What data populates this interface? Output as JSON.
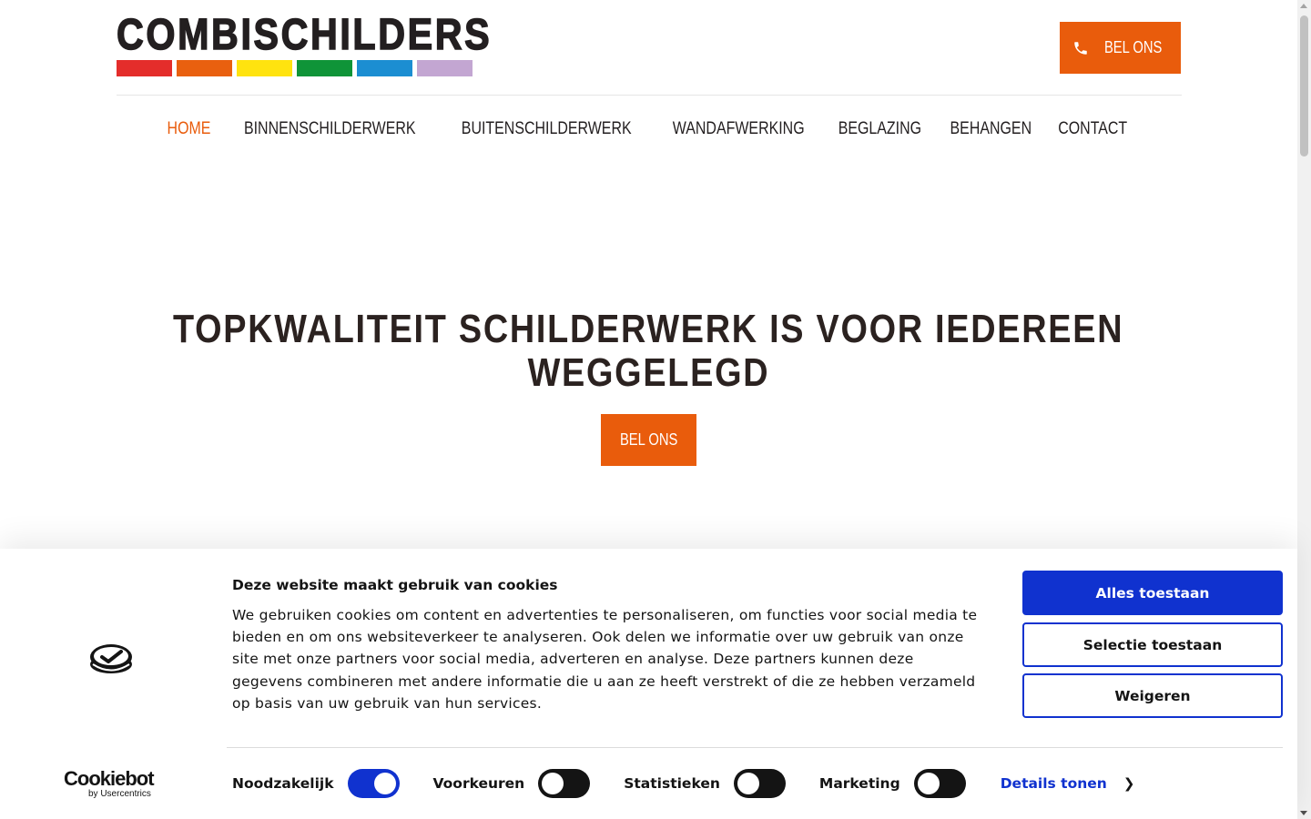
{
  "header": {
    "logo_text": "COMBISCHILDERS",
    "logo_colors": [
      "#e42d2b",
      "#e9600f",
      "#ffe30f",
      "#0f9438",
      "#1c8ed2",
      "#c3a6d2"
    ],
    "call_label": "BEL ONS"
  },
  "nav": {
    "items": [
      "HOME",
      "BINNENSCHILDERWERK",
      "BUITENSCHILDERWERK",
      "WANDAFWERKING",
      "BEGLAZING",
      "BEHANGEN",
      "CONTACT"
    ],
    "active": "HOME"
  },
  "hero": {
    "title_line1": "TOPKWALITEIT SCHILDERWERK IS VOOR IEDEREEN",
    "title_line2": "WEGGELEGD",
    "cta_label": "BEL ONS"
  },
  "cookie_banner": {
    "brand": "Cookiebot",
    "brand_sub": "by Usercentrics",
    "title": "Deze website maakt gebruik van cookies",
    "body": "We gebruiken cookies om content en advertenties te personaliseren, om functies voor social media te bieden en om ons websiteverkeer te analyseren. Ook delen we informatie over uw gebruik van onze site met onze partners voor social media, adverteren en analyse. Deze partners kunnen deze gegevens combineren met andere informatie die u aan ze heeft verstrekt of die ze hebben verzameld op basis van uw gebruik van hun services.",
    "buttons": {
      "allow_all": "Alles toestaan",
      "allow_selection": "Selectie toestaan",
      "deny": "Weigeren"
    },
    "toggles": [
      {
        "label": "Noodzakelijk",
        "on": true
      },
      {
        "label": "Voorkeuren",
        "on": false
      },
      {
        "label": "Statistieken",
        "on": false
      },
      {
        "label": "Marketing",
        "on": false
      }
    ],
    "details_label": "Details tonen"
  },
  "colors": {
    "accent_orange": "#e95c0c",
    "cookie_blue": "#1032cf",
    "text_dark": "#231f20"
  }
}
